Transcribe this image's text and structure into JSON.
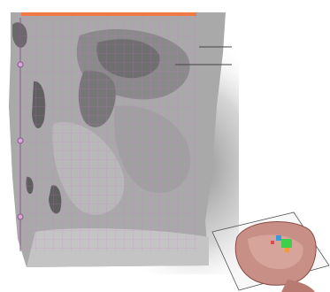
{
  "viewer": {
    "slice_view": {
      "orientation": "sagittal",
      "tissue_colors": {
        "background": "#ffffff",
        "tissue": "#a9a9a9",
        "dark_tissue": "#6f6f6f",
        "grid": "#c77bc7",
        "shadow": "#9a9a9a"
      },
      "top_bar_color": "#ef7a45",
      "scale_markers": [
        {
          "name": "scale-marker-top"
        },
        {
          "name": "scale-marker-middle"
        },
        {
          "name": "scale-marker-bottom"
        }
      ],
      "guide_lines": [
        {
          "name": "guide-line-upper"
        },
        {
          "name": "guide-line-lower"
        }
      ]
    },
    "orientation_widget": {
      "icon": "3d-head-orientation-icon",
      "head_color": "#c78f86",
      "highlight_colors": [
        "#3fd04a",
        "#3a9ae0",
        "#f09a3a",
        "#e04a4a"
      ]
    }
  }
}
